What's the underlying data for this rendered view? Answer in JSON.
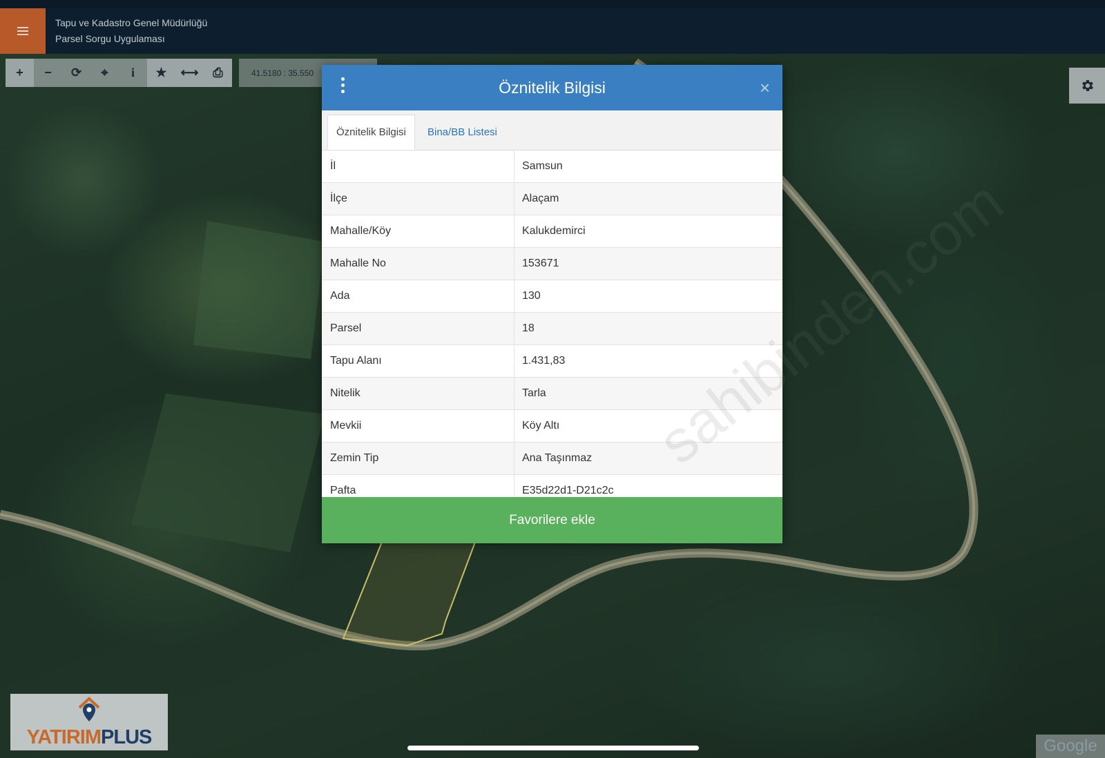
{
  "header": {
    "title": "Tapu ve Kadastro Genel Müdürlüğü",
    "subtitle": "Parsel Sorgu Uygulaması"
  },
  "toolbar": {
    "tools": [
      "plus-icon",
      "minus-icon",
      "refresh-icon",
      "crosshair-icon",
      "info-icon",
      "star-icon",
      "arrows-icon",
      "print-icon"
    ],
    "coordinates": "41.5180 : 35.550"
  },
  "modal": {
    "title": "Öznitelik Bilgisi",
    "close": "×",
    "tabs": [
      {
        "label": "Öznitelik Bilgisi",
        "active": true
      },
      {
        "label": "Bina/BB Listesi",
        "active": false
      }
    ],
    "rows": [
      {
        "key": "İl",
        "value": "Samsun"
      },
      {
        "key": "İlçe",
        "value": "Alaçam"
      },
      {
        "key": "Mahalle/Köy",
        "value": "Kalukdemirci"
      },
      {
        "key": "Mahalle No",
        "value": "153671"
      },
      {
        "key": "Ada",
        "value": "130"
      },
      {
        "key": "Parsel",
        "value": "18"
      },
      {
        "key": "Tapu Alanı",
        "value": "1.431,83"
      },
      {
        "key": "Nitelik",
        "value": "Tarla"
      },
      {
        "key": "Mevkii",
        "value": "Köy Altı"
      },
      {
        "key": "Zemin Tip",
        "value": "Ana Taşınmaz"
      },
      {
        "key": "Pafta",
        "value": "E35d22d1-D21c2c"
      }
    ],
    "add_favorite": "Favorilere ekle",
    "watermark": "sahibinden.com"
  },
  "brand": {
    "part1": "YATIRIM",
    "part2": "PLUS"
  },
  "map_attribution": "Google",
  "colors": {
    "header": "#0d1f2e",
    "menu": "#b8592a",
    "modal_head": "#3a7fc1",
    "favorite": "#59b15d"
  }
}
